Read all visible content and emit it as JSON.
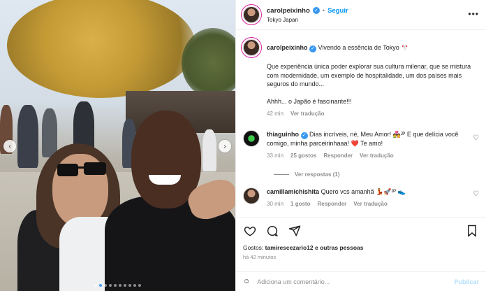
{
  "post": {
    "username": "carolpeixinho",
    "follow_label": "Seguir",
    "location": "Tokyo Japan",
    "more_label": "•••"
  },
  "caption": {
    "username": "carolpeixinho",
    "headline": "Vivendo a essência de Tokyo 🎌",
    "body": "Que experiência única poder explorar sua cultura milenar, que se mistura com modernidade, um exemplo de hospitalidade, um dos países mais seguros do mundo...",
    "closing": "Ahhh... o Japão é fascinante!!!",
    "time": "42 min",
    "see_translation": "Ver tradução"
  },
  "comments": [
    {
      "username": "thiaguinho",
      "text": "Dias incríveis, né, Meu Amor! 💑ᴶᴾ E que delícia você comigo, minha parceirinhaaa! ❤️ Te amo!",
      "time": "33 min",
      "likes": "25 gostos",
      "reply": "Responder",
      "see_translation": "Ver tradução"
    },
    {
      "username": "camillamichishita",
      "text": "Quero vcs amanhã 💃🚀ᴶᴾ 👟",
      "time": "30 min",
      "likes": "1 gosto",
      "reply": "Responder",
      "see_translation": "Ver tradução"
    }
  ],
  "view_replies": "Ver respostas (1)",
  "likes": {
    "prefix": "Gostos: ",
    "user": "tamirescezario12",
    "suffix": " e outras pessoas"
  },
  "posted_time": "há 42 minutos",
  "add_comment": {
    "placeholder": "Adiciona um comentário...",
    "post_label": "Publicar"
  },
  "carousel": {
    "total": 10,
    "active_index": 1
  }
}
